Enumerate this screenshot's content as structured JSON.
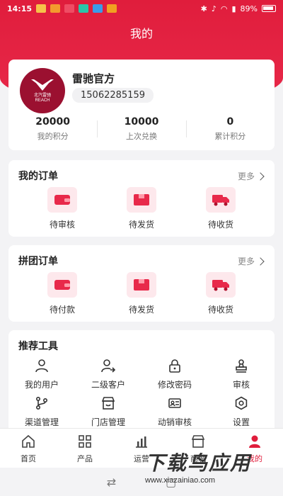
{
  "status": {
    "time": "14:15",
    "battery": "89%"
  },
  "page": {
    "title": "我的"
  },
  "profile": {
    "name": "雷驰官方",
    "phone": "15062285159",
    "logo_text_cn": "北汽雷驰",
    "logo_text_en": "REACH"
  },
  "stats": [
    {
      "value": "20000",
      "label": "我的积分"
    },
    {
      "value": "10000",
      "label": "上次兑换"
    },
    {
      "value": "0",
      "label": "累计积分"
    }
  ],
  "orders": {
    "title": "我的订单",
    "more": "更多",
    "items": [
      {
        "label": "待审核",
        "icon": "wallet-icon"
      },
      {
        "label": "待发货",
        "icon": "package-icon"
      },
      {
        "label": "待收货",
        "icon": "truck-icon"
      }
    ]
  },
  "group_orders": {
    "title": "拼团订单",
    "more": "更多",
    "items": [
      {
        "label": "待付款",
        "icon": "wallet-icon"
      },
      {
        "label": "待发货",
        "icon": "package-icon"
      },
      {
        "label": "待收货",
        "icon": "truck-icon"
      }
    ]
  },
  "tools": {
    "title": "推荐工具",
    "items": [
      {
        "label": "我的用户",
        "icon": "user-icon"
      },
      {
        "label": "二级客户",
        "icon": "user-share-icon"
      },
      {
        "label": "修改密码",
        "icon": "lock-icon"
      },
      {
        "label": "审核",
        "icon": "stamp-icon"
      },
      {
        "label": "渠道管理",
        "icon": "channel-icon"
      },
      {
        "label": "门店管理",
        "icon": "store-icon"
      },
      {
        "label": "动销审核",
        "icon": "id-card-icon"
      },
      {
        "label": "设置",
        "icon": "settings-icon"
      }
    ]
  },
  "tabbar": [
    {
      "label": "首页",
      "icon": "home-icon"
    },
    {
      "label": "产品",
      "icon": "grid-icon"
    },
    {
      "label": "运营",
      "icon": "chart-icon"
    },
    {
      "label": "商城",
      "icon": "shop-icon"
    },
    {
      "label": "我的",
      "icon": "profile-icon",
      "active": true
    }
  ],
  "watermark": {
    "title": "下载鸟应用",
    "url": "www.xiazainiao.com"
  },
  "colors": {
    "brand": "#e01d3c",
    "tile_bg": "#fde8ec"
  }
}
